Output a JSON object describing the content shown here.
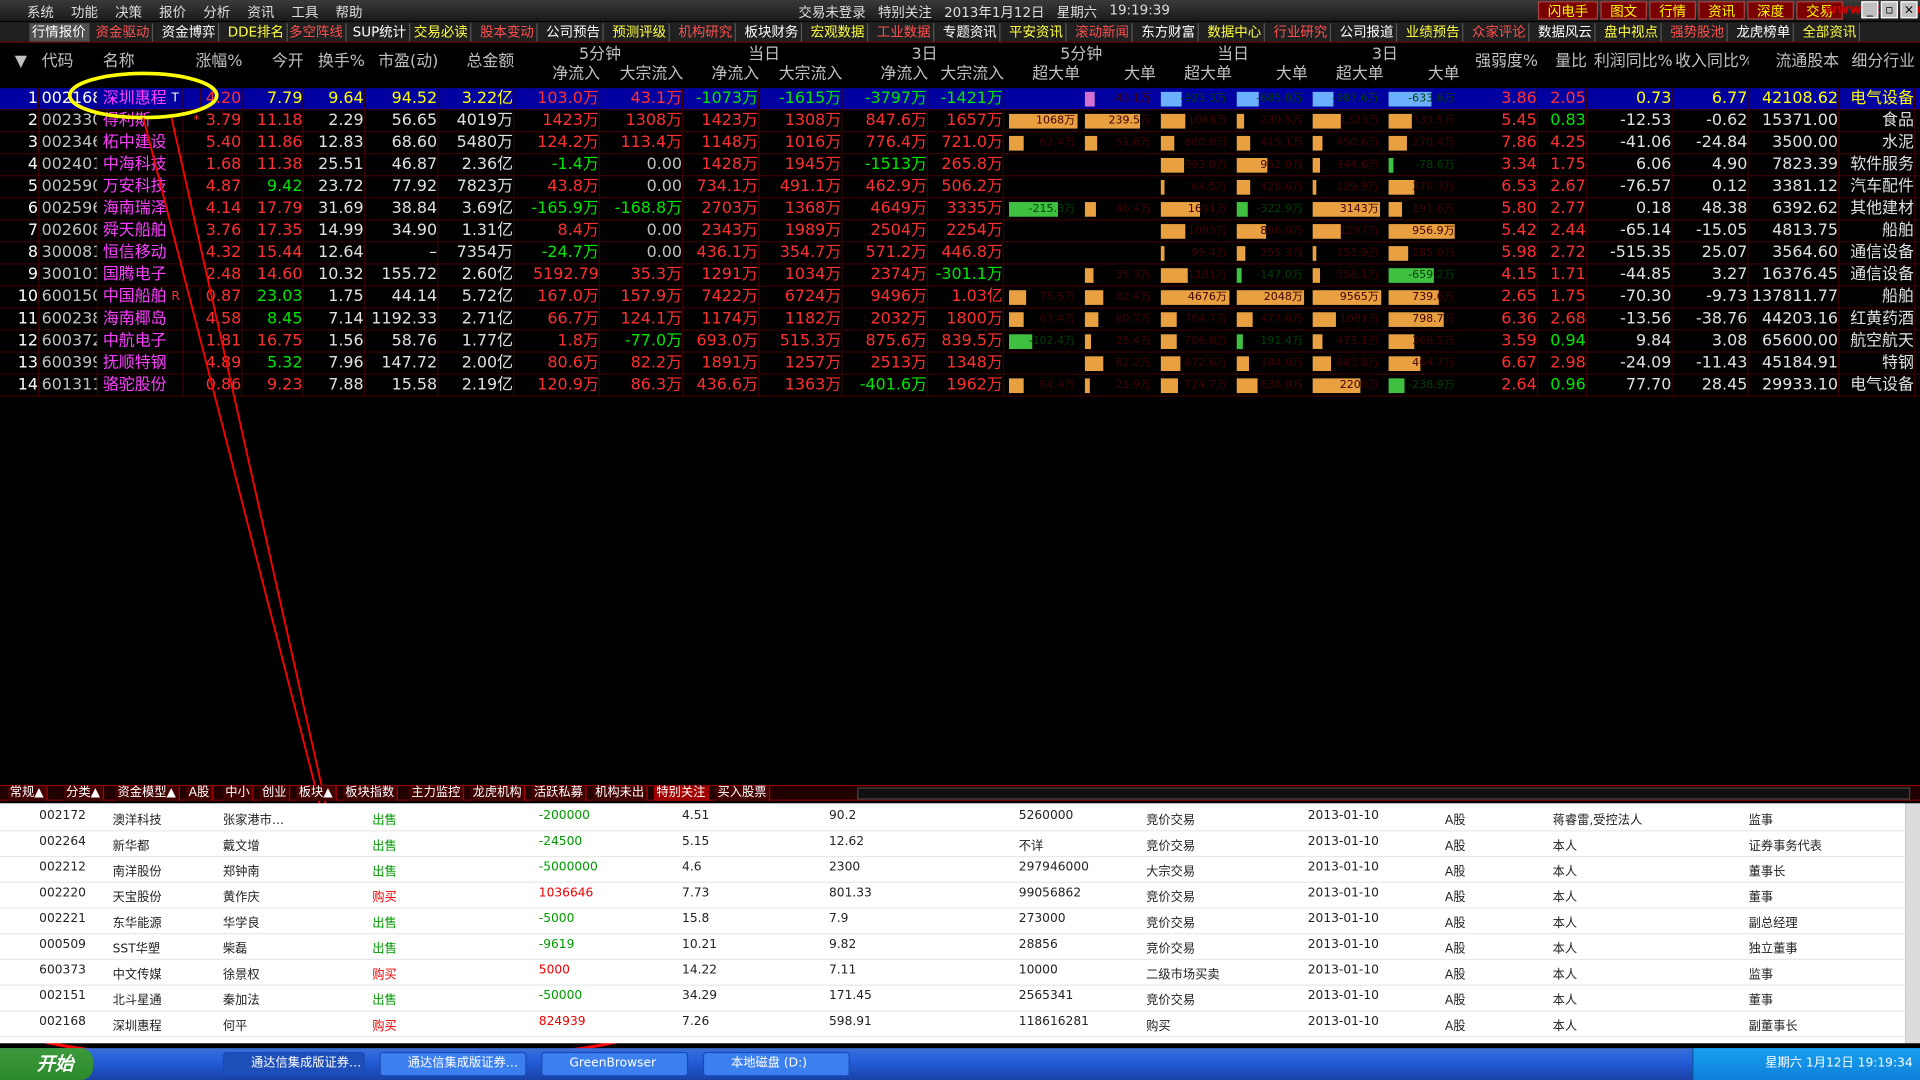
{
  "menu": [
    "系统",
    "功能",
    "决策",
    "报价",
    "分析",
    "资讯",
    "工具",
    "帮助"
  ],
  "center_title": [
    "交易未登录",
    "特别关注",
    "2013年1月12日",
    "星期六",
    "19:19:39"
  ],
  "right_buttons": [
    "闪电手",
    "图文",
    "行情",
    "资讯",
    "深度",
    "交易"
  ],
  "logo_text": "www.fxx8.com",
  "top_tabs": [
    "行情报价",
    "资金驱动",
    "资金博弈",
    "DDE排名",
    "多空阵线",
    "SUP统计",
    "交易必读",
    "股本变动",
    "公司预告",
    "预测评级",
    "机构研究",
    "板块财务",
    "宏观数据",
    "工业数据",
    "专题资讯",
    "平安资讯",
    "滚动新闻",
    "东方财富",
    "数据中心",
    "行业研究",
    "公司报道",
    "业绩预告",
    "众家评论",
    "数据风云",
    "盘中视点",
    "强势股池",
    "龙虎榜单",
    "全部资讯"
  ],
  "header": {
    "groups": [
      "5分钟",
      "当日",
      "3日",
      "5分钟",
      "当日",
      "3日"
    ],
    "cols": [
      "代码",
      "名称",
      "涨幅%",
      "今开",
      "换手%",
      "市盈(动)",
      "总金额",
      "净流入",
      "大宗流入",
      "净流入",
      "大宗流入",
      "净流入",
      "大宗流入",
      "超大单",
      "大单",
      "超大单",
      "大单",
      "超大单",
      "大单",
      "强弱度%",
      "量比",
      "利润同比%",
      "收入同比%",
      "流通股本",
      "细分行业"
    ]
  },
  "rows": [
    {
      "n": "1",
      "code": "002168",
      "name": "深圳惠程",
      "flag": "T",
      "chg": "4.20",
      "open": "7.79",
      "turn": "9.64",
      "pe": "94.52",
      "amt": "3.22亿",
      "f1": "103.0万",
      "f2": "43.1万",
      "f3": "-1073万",
      "f4": "-1615万",
      "f5": "-3797万",
      "f6": "-1421万",
      "b1": "",
      "b2": "43.1万",
      "b3": "-923.3万",
      "b4": "-685.0万",
      "b5": "-987.6万",
      "b6": "-633.6万",
      "str": "3.86",
      "lb": "2.05",
      "p": "0.73",
      "s": "6.77",
      "float": "42108.62",
      "ind": "电气设备"
    },
    {
      "n": "2",
      "code": "002330",
      "name": "得利斯",
      "flag": "*",
      "chg": "3.79",
      "open": "11.18",
      "turn": "2.29",
      "pe": "56.65",
      "amt": "4019万",
      "f1": "1423万",
      "f2": "1308万",
      "f3": "1423万",
      "f4": "1308万",
      "f5": "847.6万",
      "f6": "1657万",
      "b1": "1068万",
      "b2": "239.5万",
      "b3": "1068万",
      "b4": "239.5万",
      "b5": "1323万",
      "b6": "333.5万",
      "str": "5.45",
      "lb": "0.83",
      "p": "-12.53",
      "s": "-0.62",
      "float": "15371.00",
      "ind": "食品"
    },
    {
      "n": "3",
      "code": "002346",
      "name": "柘中建设",
      "flag": "",
      "chg": "5.40",
      "open": "11.86",
      "turn": "12.83",
      "pe": "68.60",
      "amt": "5480万",
      "f1": "124.2万",
      "f2": "113.4万",
      "f3": "1148万",
      "f4": "1016万",
      "f5": "776.4万",
      "f6": "721.0万",
      "b1": "62.4万",
      "b2": "51.6万",
      "b3": "600.8万",
      "b4": "415.1万",
      "b5": "450.6万",
      "b6": "270.4万",
      "str": "7.86",
      "lb": "4.25",
      "p": "-41.06",
      "s": "-24.84",
      "float": "3500.00",
      "ind": "水泥"
    },
    {
      "n": "4",
      "code": "002401",
      "name": "中海科技",
      "flag": "",
      "chg": "1.68",
      "open": "11.38",
      "turn": "25.51",
      "pe": "46.87",
      "amt": "2.36亿",
      "f1": "-1.4万",
      "f2": "0.00",
      "f3": "1428万",
      "f4": "1945万",
      "f5": "-1513万",
      "f6": "265.8万",
      "b1": "",
      "b2": "",
      "b3": "993.0万",
      "b4": "952.0万",
      "b5": "344.6万",
      "b6": "-78.6万",
      "str": "3.34",
      "lb": "1.75",
      "p": "6.06",
      "s": "4.90",
      "float": "7823.39",
      "ind": "软件服务"
    },
    {
      "n": "5",
      "code": "002590",
      "name": "万安科技",
      "flag": "",
      "chg": "4.87",
      "open": "9.42",
      "turn": "23.72",
      "pe": "77.92",
      "amt": "7823万",
      "f1": "43.8万",
      "f2": "0.00",
      "f3": "734.1万",
      "f4": "491.1万",
      "f5": "462.9万",
      "f6": "506.2万",
      "b1": "",
      "b2": "",
      "b3": "64.5万",
      "b4": "426.6万",
      "b5": "129.9万",
      "b6": "376.3万",
      "str": "6.53",
      "lb": "2.67",
      "p": "-76.57",
      "s": "0.12",
      "float": "3381.12",
      "ind": "汽车配件"
    },
    {
      "n": "6",
      "code": "002596",
      "name": "海南瑞泽",
      "flag": "",
      "chg": "4.14",
      "open": "17.79",
      "turn": "31.69",
      "pe": "38.84",
      "amt": "3.69亿",
      "f1": "-165.9万",
      "f2": "-168.8万",
      "f3": "2703万",
      "f4": "1368万",
      "f5": "4649万",
      "f6": "3335万",
      "b1": "-215.3万",
      "b2": "46.4万",
      "b3": "1691万",
      "b4": "-322.9万",
      "b5": "3143万",
      "b6": "191.6万",
      "str": "5.80",
      "lb": "2.77",
      "p": "0.18",
      "s": "48.38",
      "float": "6392.62",
      "ind": "其他建材"
    },
    {
      "n": "7",
      "code": "002608",
      "name": "舜天船舶",
      "flag": "",
      "chg": "3.76",
      "open": "17.35",
      "turn": "14.99",
      "pe": "34.90",
      "amt": "1.31亿",
      "f1": "8.4万",
      "f2": "0.00",
      "f3": "2343万",
      "f4": "1989万",
      "f5": "2504万",
      "f6": "2254万",
      "b1": "",
      "b2": "",
      "b3": "1093万",
      "b4": "896.0万",
      "b5": "1297万",
      "b6": "956.9万",
      "str": "5.42",
      "lb": "2.44",
      "p": "-65.14",
      "s": "-15.05",
      "float": "4813.75",
      "ind": "船舶"
    },
    {
      "n": "8",
      "code": "300081",
      "name": "恒信移动",
      "flag": "",
      "chg": "4.32",
      "open": "15.44",
      "turn": "12.64",
      "pe": "–",
      "amt": "7354万",
      "f1": "-24.7万",
      "f2": "0.00",
      "f3": "436.1万",
      "f4": "354.7万",
      "f5": "571.2万",
      "f6": "446.8万",
      "b1": "",
      "b2": "",
      "b3": "99.4万",
      "b4": "255.3万",
      "b5": "151.9万",
      "b6": "285.0万",
      "str": "5.98",
      "lb": "2.72",
      "p": "-515.35",
      "s": "25.07",
      "float": "3564.60",
      "ind": "通信设备"
    },
    {
      "n": "9",
      "code": "300101",
      "name": "国腾电子",
      "flag": "",
      "chg": "2.48",
      "open": "14.60",
      "turn": "10.32",
      "pe": "155.72",
      "amt": "2.60亿",
      "f1": "5192.79",
      "f2": "35.3万",
      "f3": "1291万",
      "f4": "1034万",
      "f5": "2374万",
      "f6": "-301.1万",
      "b1": "",
      "b2": "35.3万",
      "b3": "1181万",
      "b4": "-147.0万",
      "b5": "358.1万",
      "b6": "-659.2万",
      "str": "4.15",
      "lb": "1.71",
      "p": "-44.85",
      "s": "3.27",
      "float": "16376.45",
      "ind": "通信设备"
    },
    {
      "n": "10",
      "code": "600150",
      "name": "中国船舶",
      "flag": "R",
      "chg": "0.87",
      "open": "23.03",
      "turn": "1.75",
      "pe": "44.14",
      "amt": "5.72亿",
      "f1": "167.0万",
      "f2": "157.9万",
      "f3": "7422万",
      "f4": "6724万",
      "f5": "9496万",
      "f6": "1.03亿",
      "b1": "75.5万",
      "b2": "82.4万",
      "b3": "4676万",
      "b4": "2048万",
      "b5": "9565万",
      "b6": "739.6万",
      "str": "2.65",
      "lb": "1.75",
      "p": "-70.30",
      "s": "-9.73",
      "float": "137811.77",
      "ind": "船舶"
    },
    {
      "n": "11",
      "code": "600238",
      "name": "海南椰岛",
      "flag": "",
      "chg": "4.58",
      "open": "8.45",
      "turn": "7.14",
      "pe": "1192.33",
      "amt": "2.71亿",
      "f1": "66.7万",
      "f2": "124.1万",
      "f3": "1174万",
      "f4": "1182万",
      "f5": "2032万",
      "f6": "1800万",
      "b1": "63.4万",
      "b2": "60.7万",
      "b3": "704.7万",
      "b4": "477.0万",
      "b5": "1081万",
      "b6": "798.7万",
      "str": "6.36",
      "lb": "2.68",
      "p": "-13.56",
      "s": "-38.76",
      "float": "44203.16",
      "ind": "红黄药酒"
    },
    {
      "n": "12",
      "code": "600372",
      "name": "中航电子",
      "flag": "",
      "chg": "1.81",
      "open": "16.75",
      "turn": "1.56",
      "pe": "58.76",
      "amt": "1.77亿",
      "f1": "1.8万",
      "f2": "-77.0万",
      "f3": "693.0万",
      "f4": "515.3万",
      "f5": "875.6万",
      "f6": "839.5万",
      "b1": "-102.4万",
      "b2": "25.4万",
      "b3": "706.8万",
      "b4": "-191.4万",
      "b5": "473.1万",
      "b6": "366.5万",
      "str": "3.59",
      "lb": "0.94",
      "p": "9.84",
      "s": "3.08",
      "float": "65600.00",
      "ind": "航空航天"
    },
    {
      "n": "13",
      "code": "600399",
      "name": "抚顺特钢",
      "flag": "",
      "chg": "4.89",
      "open": "5.32",
      "turn": "7.96",
      "pe": "147.72",
      "amt": "2.00亿",
      "f1": "80.6万",
      "f2": "82.2万",
      "f3": "1891万",
      "f4": "1257万",
      "f5": "2513万",
      "f6": "1348万",
      "b1": "",
      "b2": "82.2万",
      "b3": "872.6万",
      "b4": "384.0万",
      "b5": "883.8万",
      "b6": "464.7万",
      "str": "6.67",
      "lb": "2.98",
      "p": "-24.09",
      "s": "-11.43",
      "float": "45184.91",
      "ind": "特钢"
    },
    {
      "n": "14",
      "code": "601311",
      "name": "骆驼股份",
      "flag": "",
      "chg": "0.86",
      "open": "9.23",
      "turn": "7.88",
      "pe": "15.58",
      "amt": "2.19亿",
      "f1": "120.9万",
      "f2": "86.3万",
      "f3": "436.6万",
      "f4": "1363万",
      "f5": "-401.6万",
      "f6": "1962万",
      "b1": "64.4万",
      "b2": "21.9万",
      "b3": "724.7万",
      "b4": "638.0万",
      "b5": "2200万",
      "b6": "-238.9万",
      "str": "2.64",
      "lb": "0.96",
      "p": "77.70",
      "s": "28.45",
      "float": "29933.10",
      "ind": "电气设备"
    }
  ],
  "bottom_tabs": [
    "常规▲",
    "分类▲",
    "资金模型▲",
    "A股",
    "中小",
    "创业",
    "板块▲",
    "板块指数",
    "主力监控",
    "龙虎机构",
    "活跃私募",
    "机构未出",
    "特别关注",
    "买入股票"
  ],
  "trades": [
    {
      "code": "002172",
      "name": "澳洋科技",
      "holder": "张家港市…",
      "type": "出售",
      "vol": "-200000",
      "price": "4.51",
      "money": "90.2",
      "after": "5260000",
      "method": "竞价交易",
      "date": "2013-01-10",
      "cls": "A股",
      "rel": "蒋睿雷,受控法人",
      "pos": "监事"
    },
    {
      "code": "002264",
      "name": "新华都",
      "holder": "戴文增",
      "type": "出售",
      "vol": "-24500",
      "price": "5.15",
      "money": "12.62",
      "after": "不详",
      "method": "竞价交易",
      "date": "2013-01-10",
      "cls": "A股",
      "rel": "本人",
      "pos": "证券事务代表"
    },
    {
      "code": "002212",
      "name": "南洋股份",
      "holder": "郑钟南",
      "type": "出售",
      "vol": "-5000000",
      "price": "4.6",
      "money": "2300",
      "after": "297946000",
      "method": "大宗交易",
      "date": "2013-01-10",
      "cls": "A股",
      "rel": "本人",
      "pos": "董事长"
    },
    {
      "code": "002220",
      "name": "天宝股份",
      "holder": "黄作庆",
      "type": "购买",
      "vol": "1036646",
      "price": "7.73",
      "money": "801.33",
      "after": "99056862",
      "method": "竞价交易",
      "date": "2013-01-10",
      "cls": "A股",
      "rel": "本人",
      "pos": "董事"
    },
    {
      "code": "002221",
      "name": "东华能源",
      "holder": "华学良",
      "type": "出售",
      "vol": "-5000",
      "price": "15.8",
      "money": "7.9",
      "after": "273000",
      "method": "竞价交易",
      "date": "2013-01-10",
      "cls": "A股",
      "rel": "本人",
      "pos": "副总经理"
    },
    {
      "code": "000509",
      "name": "SST华塑",
      "holder": "柴磊",
      "type": "出售",
      "vol": "-9619",
      "price": "10.21",
      "money": "9.82",
      "after": "28856",
      "method": "竞价交易",
      "date": "2013-01-10",
      "cls": "A股",
      "rel": "本人",
      "pos": "独立董事"
    },
    {
      "code": "600373",
      "name": "中文传媒",
      "holder": "徐景权",
      "type": "购买",
      "vol": "5000",
      "price": "14.22",
      "money": "7.11",
      "after": "10000",
      "method": "二级市场买卖",
      "date": "2013-01-10",
      "cls": "A股",
      "rel": "本人",
      "pos": "监事"
    },
    {
      "code": "002151",
      "name": "北斗星通",
      "holder": "秦加法",
      "type": "出售",
      "vol": "-50000",
      "price": "34.29",
      "money": "171.45",
      "after": "2565341",
      "method": "竞价交易",
      "date": "2013-01-10",
      "cls": "A股",
      "rel": "本人",
      "pos": "董事"
    },
    {
      "code": "002168",
      "name": "深圳惠程",
      "holder": "何平",
      "type": "购买",
      "vol": "824939",
      "price": "7.26",
      "money": "598.91",
      "after": "118616281",
      "method": "购买",
      "date": "2013-01-10",
      "cls": "A股",
      "rel": "本人",
      "pos": "副董事长"
    }
  ],
  "taskbar": {
    "start": "开始",
    "tasks": [
      "通达信集成版证券…",
      "通达信集成版证券…",
      "GreenBrowser",
      "本地磁盘 (D:)"
    ],
    "clock": "星期六  1月12日  19:19:34"
  },
  "colors": {
    "accent_red": "#ff3030",
    "up": "#ff3030",
    "down": "#00e600",
    "name": "#ff40ff",
    "bar_orange": "#e8a040",
    "bar_green": "#40c040",
    "highlight_row": "#0000a0"
  }
}
